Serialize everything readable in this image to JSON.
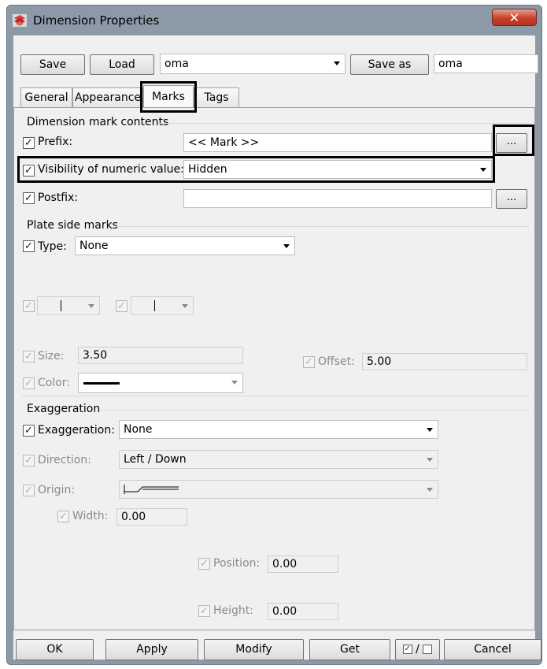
{
  "window": {
    "title": "Dimension Properties",
    "close_label": "✕"
  },
  "toolbar": {
    "save_label": "Save",
    "load_label": "Load",
    "load_select_value": "oma",
    "save_as_label": "Save as",
    "save_as_value": "oma"
  },
  "tabs": [
    {
      "label": "General"
    },
    {
      "label": "Appearance"
    },
    {
      "label": "Marks"
    },
    {
      "label": "Tags"
    }
  ],
  "contents": {
    "group_label": "Dimension mark contents",
    "prefix_label": "Prefix:",
    "prefix_value": "<< Mark >>",
    "prefix_browse": "...",
    "visibility_label": "Visibility of numeric value:",
    "visibility_value": "Hidden",
    "postfix_label": "Postfix:",
    "postfix_value": "",
    "postfix_browse": "..."
  },
  "plate": {
    "group_label": "Plate side marks",
    "type_label": "Type:",
    "type_value": "None",
    "size_label": "Size:",
    "size_value": "3.50",
    "offset_label": "Offset:",
    "offset_value": "5.00",
    "color_label": "Color:"
  },
  "exaggeration": {
    "group_label": "Exaggeration",
    "exaggeration_label": "Exaggeration:",
    "exaggeration_value": "None",
    "direction_label": "Direction:",
    "direction_value": "Left / Down",
    "origin_label": "Origin:",
    "width_label": "Width:",
    "width_value": "0.00",
    "position_label": "Position:",
    "position_value": "0.00",
    "height_label": "Height:",
    "height_value": "0.00"
  },
  "footer": {
    "ok_label": "OK",
    "apply_label": "Apply",
    "modify_label": "Modify",
    "get_label": "Get",
    "toggle_label": "/",
    "cancel_label": "Cancel"
  },
  "colors": {
    "frame": "#8c9aa8",
    "close_button": "#c7402c",
    "client": "#f0f0f0",
    "highlight": "#000000"
  }
}
